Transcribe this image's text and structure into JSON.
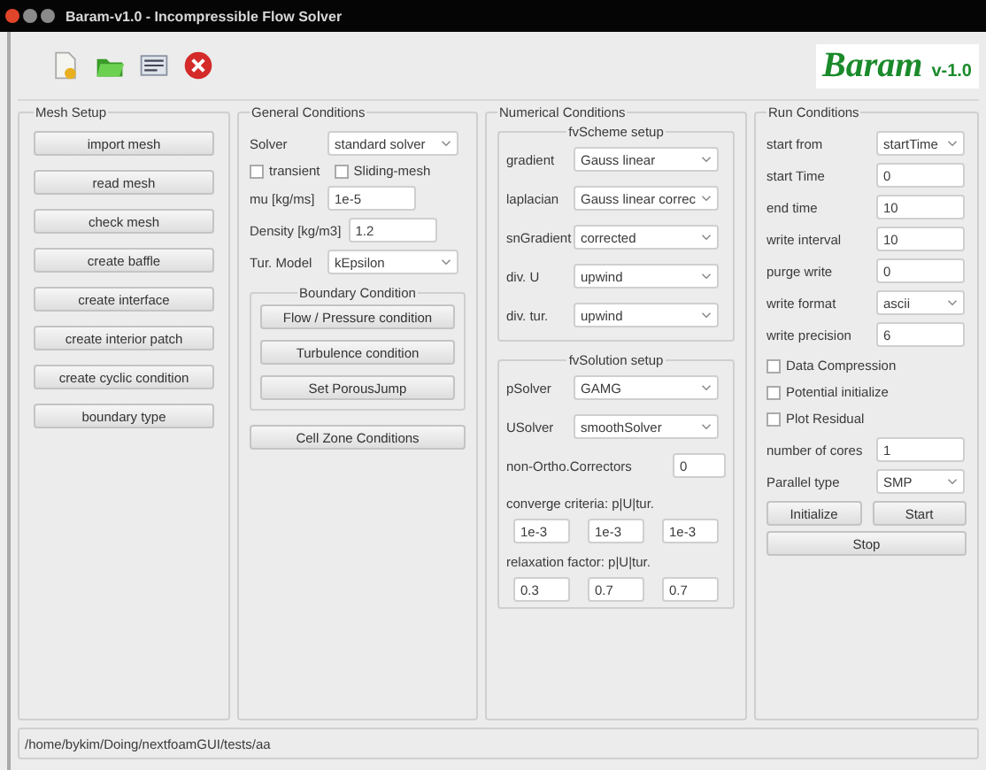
{
  "window": {
    "title": "Baram-v1.0 - Incompressible Flow Solver"
  },
  "toolbar": {
    "tools": [
      {
        "kind": "new"
      },
      {
        "kind": "open"
      },
      {
        "kind": "log"
      },
      {
        "kind": "exit"
      }
    ],
    "logo": {
      "name": "Baram",
      "version": "v-1.0"
    }
  },
  "mesh_setup": {
    "title": "Mesh Setup",
    "buttons": [
      "import mesh",
      "read mesh",
      "check mesh",
      "create baffle",
      "create interface",
      "create interior patch",
      "create cyclic condition",
      "boundary type"
    ]
  },
  "general_conditions": {
    "title": "General Conditions",
    "solver": {
      "label": "Solver",
      "value": "standard solver"
    },
    "options": [
      {
        "label": "transient",
        "checked": false
      },
      {
        "label": "Sliding-mesh",
        "checked": false
      }
    ],
    "fields": [
      {
        "kind": "input",
        "label": "mu [kg/ms]",
        "value": "1e-5"
      },
      {
        "kind": "input",
        "label": "Density [kg/m3]",
        "value": "1.2"
      },
      {
        "kind": "select",
        "label": "Tur. Model",
        "value": "kEpsilon"
      }
    ],
    "boundary_condition": {
      "title": "Boundary Condition",
      "buttons": [
        "Flow / Pressure condition",
        "Turbulence condition",
        "Set PorousJump"
      ]
    },
    "cell_zone_button": "Cell Zone Conditions"
  },
  "numerical_conditions": {
    "title": "Numerical Conditions",
    "fvscheme": {
      "title": "fvScheme setup",
      "rows": [
        {
          "label": "gradient",
          "value": "Gauss linear"
        },
        {
          "label": "laplacian",
          "value": "Gauss linear correc"
        },
        {
          "label": "snGradient",
          "value": "corrected"
        },
        {
          "label": "div. U",
          "value": "upwind"
        },
        {
          "label": "div. tur.",
          "value": "upwind"
        }
      ]
    },
    "fvsolution": {
      "title": "fvSolution setup",
      "rows": [
        {
          "label": "pSolver",
          "value": "GAMG"
        },
        {
          "label": "USolver",
          "value": "smoothSolver"
        }
      ],
      "non_ortho": {
        "label": "non-Ortho.Correctors",
        "value": "0"
      },
      "converge": {
        "label": "converge criteria: p|U|tur.",
        "values": [
          "1e-3",
          "1e-3",
          "1e-3"
        ]
      },
      "relaxation": {
        "label": "relaxation factor: p|U|tur.",
        "values": [
          "0.3",
          "0.7",
          "0.7"
        ]
      }
    }
  },
  "run_conditions": {
    "title": "Run Conditions",
    "rows": [
      {
        "kind": "select",
        "label": "start from",
        "value": "startTime"
      },
      {
        "kind": "input",
        "label": "start Time",
        "value": "0"
      },
      {
        "kind": "input",
        "label": "end time",
        "value": "10"
      },
      {
        "kind": "input",
        "label": "write interval",
        "value": "10"
      },
      {
        "kind": "input",
        "label": "purge write",
        "value": "0"
      },
      {
        "kind": "select",
        "label": "write format",
        "value": "ascii"
      },
      {
        "kind": "input",
        "label": "write precision",
        "value": "6"
      }
    ],
    "options": [
      {
        "label": "Data Compression",
        "checked": false
      },
      {
        "label": "Potential initialize",
        "checked": false
      },
      {
        "label": "Plot Residual",
        "checked": false
      }
    ],
    "rows2": [
      {
        "kind": "input",
        "label": "number of cores",
        "value": "1"
      },
      {
        "kind": "select",
        "label": "Parallel type",
        "value": "SMP"
      }
    ],
    "buttons": [
      "Initialize",
      "Start"
    ],
    "stop_button": "Stop"
  },
  "status_bar": {
    "path": "/home/bykim/Doing/nextfoamGUI/tests/aa"
  }
}
